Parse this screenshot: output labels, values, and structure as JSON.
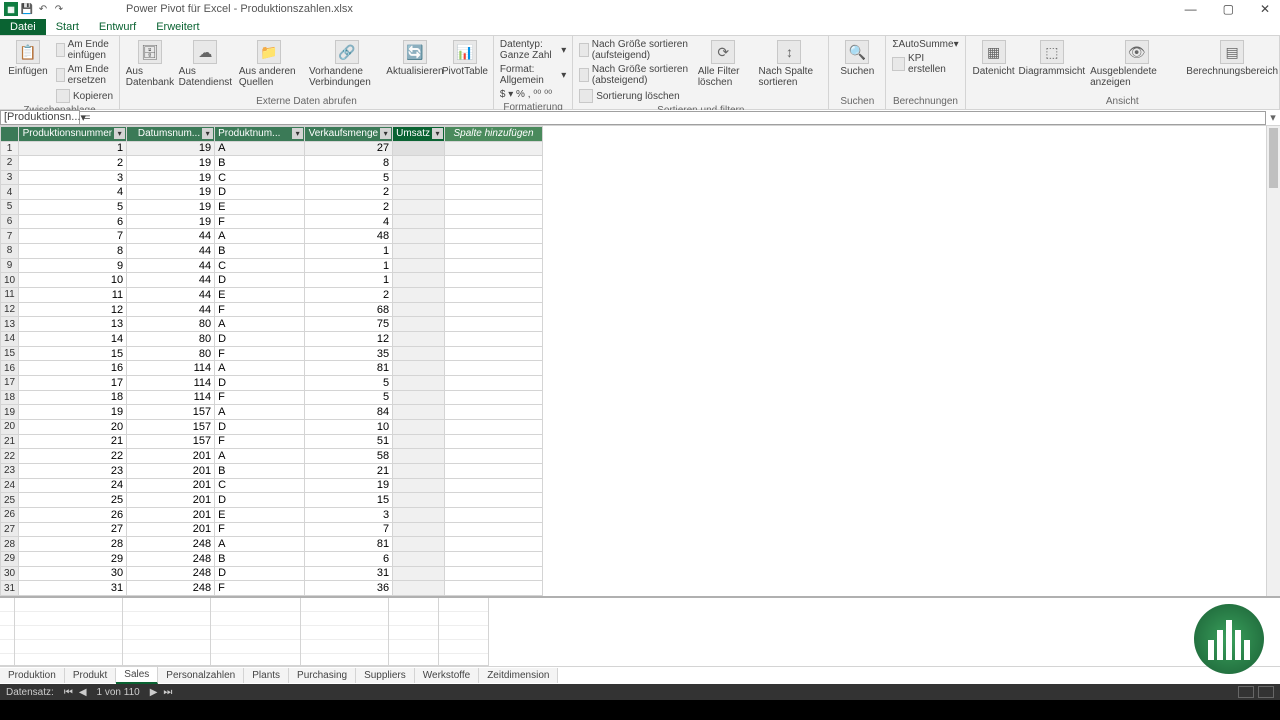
{
  "window": {
    "title": "Power Pivot für Excel - Produktionszahlen.xlsx"
  },
  "tabs": [
    "Datei",
    "Start",
    "Entwurf",
    "Erweitert"
  ],
  "tabs_active": 0,
  "ribbon": {
    "clipboard": {
      "paste": "Einfügen",
      "append": "Am Ende einfügen",
      "replace": "Am Ende ersetzen",
      "copy": "Kopieren",
      "label": "Zwischenablage"
    },
    "extdata": {
      "db": "Aus Datenbank",
      "svc": "Aus Datendienst",
      "other": "Aus anderen Quellen",
      "existing": "Vorhandene Verbindungen",
      "refresh": "Aktualisieren",
      "pivot": "PivotTable",
      "label": "Externe Daten abrufen"
    },
    "format": {
      "datatype": "Datentyp: Ganze Zahl",
      "fmt": "Format: Allgemein",
      "label": "Formatierung"
    },
    "sort": {
      "asc": "Nach Größe sortieren (aufsteigend)",
      "desc": "Nach Größe sortieren (absteigend)",
      "clear": "Sortierung löschen",
      "allfilter": "Alle Filter löschen",
      "bycol": "Nach Spalte sortieren",
      "label": "Sortieren und filtern"
    },
    "find": {
      "find": "Suchen",
      "label": "Suchen"
    },
    "calc": {
      "autosum": "AutoSumme",
      "kpi": "KPI erstellen",
      "label": "Berechnungen"
    },
    "view": {
      "data": "Datenicht",
      "diagram": "Diagrammsicht",
      "hidden": "Ausgeblendete anzeigen",
      "calcarea": "Berechnungsbereich",
      "label": "Ansicht"
    }
  },
  "formula": {
    "namebox": "[Produktionsn...",
    "value": "="
  },
  "columns": [
    "Produktionsnummer",
    "Datumsnum...",
    "Produktnum...",
    "Verkaufsmenge",
    "Umsatz"
  ],
  "addcol": "Spalte hinzufügen",
  "rows": [
    [
      1,
      19,
      "A",
      27
    ],
    [
      2,
      19,
      "B",
      8
    ],
    [
      3,
      19,
      "C",
      5
    ],
    [
      4,
      19,
      "D",
      2
    ],
    [
      5,
      19,
      "E",
      2
    ],
    [
      6,
      19,
      "F",
      4
    ],
    [
      7,
      44,
      "A",
      48
    ],
    [
      8,
      44,
      "B",
      1
    ],
    [
      9,
      44,
      "C",
      1
    ],
    [
      10,
      44,
      "D",
      1
    ],
    [
      11,
      44,
      "E",
      2
    ],
    [
      12,
      44,
      "F",
      68
    ],
    [
      13,
      80,
      "A",
      75
    ],
    [
      14,
      80,
      "D",
      12
    ],
    [
      15,
      80,
      "F",
      35
    ],
    [
      16,
      114,
      "A",
      81
    ],
    [
      17,
      114,
      "D",
      5
    ],
    [
      18,
      114,
      "F",
      5
    ],
    [
      19,
      157,
      "A",
      84
    ],
    [
      20,
      157,
      "D",
      10
    ],
    [
      21,
      157,
      "F",
      51
    ],
    [
      22,
      201,
      "A",
      58
    ],
    [
      23,
      201,
      "B",
      21
    ],
    [
      24,
      201,
      "C",
      19
    ],
    [
      25,
      201,
      "D",
      15
    ],
    [
      26,
      201,
      "E",
      3
    ],
    [
      27,
      201,
      "F",
      7
    ],
    [
      28,
      248,
      "A",
      81
    ],
    [
      29,
      248,
      "B",
      6
    ],
    [
      30,
      248,
      "D",
      31
    ],
    [
      31,
      248,
      "F",
      36
    ]
  ],
  "sheets": [
    "Produktion",
    "Produkt",
    "Sales",
    "Personalzahlen",
    "Plants",
    "Purchasing",
    "Suppliers",
    "Werkstoffe",
    "Zeitdimension"
  ],
  "sheets_active": 2,
  "status": {
    "label": "Datensatz:",
    "pos": "1 von 110"
  }
}
